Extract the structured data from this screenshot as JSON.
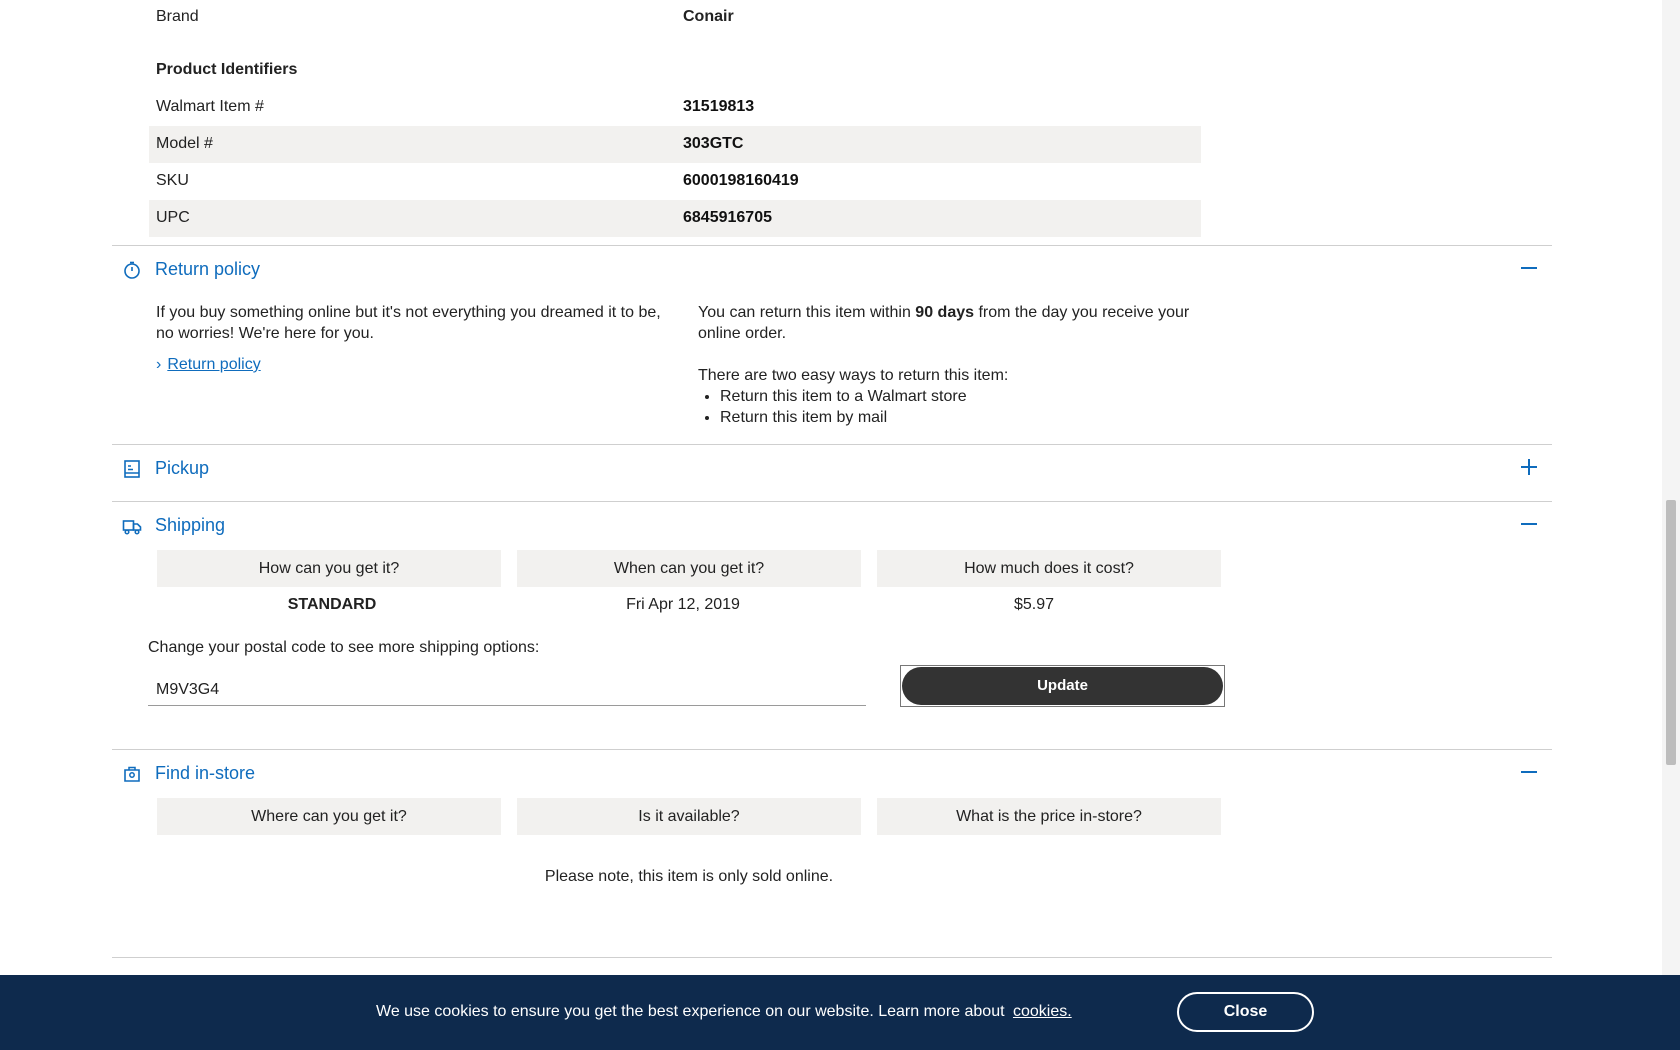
{
  "specs": {
    "brand_label": "Brand",
    "brand_value": "Conair",
    "identifiers_heading": "Product Identifiers",
    "rows": [
      {
        "label": "Walmart Item #",
        "value": "31519813"
      },
      {
        "label": "Model #",
        "value": "303GTC"
      },
      {
        "label": "SKU",
        "value": "6000198160419"
      },
      {
        "label": "UPC",
        "value": "6845916705"
      }
    ]
  },
  "return_policy": {
    "title": "Return policy",
    "intro": "If you buy something online but it's not everything you dreamed it to be, no worries! We're here for you.",
    "link_label": "Return policy",
    "text_before": "You can return this item within ",
    "days": "90 days",
    "text_after": " from the day you receive your online order.",
    "ways_intro": "There are two easy ways to return this item:",
    "ways": [
      "Return this item to a Walmart store",
      "Return this item by mail"
    ]
  },
  "pickup": {
    "title": "Pickup"
  },
  "shipping": {
    "title": "Shipping",
    "headers": [
      "How can you get it?",
      "When can you get it?",
      "How much does it cost?"
    ],
    "method": "STANDARD",
    "date": "Fri Apr 12, 2019",
    "cost": "$5.97",
    "postal_prompt": "Change your postal code to see more shipping options:",
    "postal_value": "M9V3G4",
    "update_label": "Update"
  },
  "find_in_store": {
    "title": "Find in-store",
    "headers": [
      "Where can you get it?",
      "Is it available?",
      "What is the price in-store?"
    ],
    "note": "Please note, this item is only sold online."
  },
  "cookie_bar": {
    "message": "We use cookies to ensure you get the best experience on our website. Learn more about",
    "link_label": "cookies.",
    "close_label": "Close"
  },
  "colors": {
    "accent": "#0f6cbd",
    "cookie_bg": "#0e2a4d",
    "button_dark": "#333333",
    "row_shade": "#f2f1ef"
  },
  "icons": {
    "return_policy": "timer-icon",
    "pickup": "receipt-icon",
    "shipping": "truck-icon",
    "find_in_store": "store-pin-icon",
    "collapse": "minus-icon",
    "expand": "plus-icon"
  }
}
